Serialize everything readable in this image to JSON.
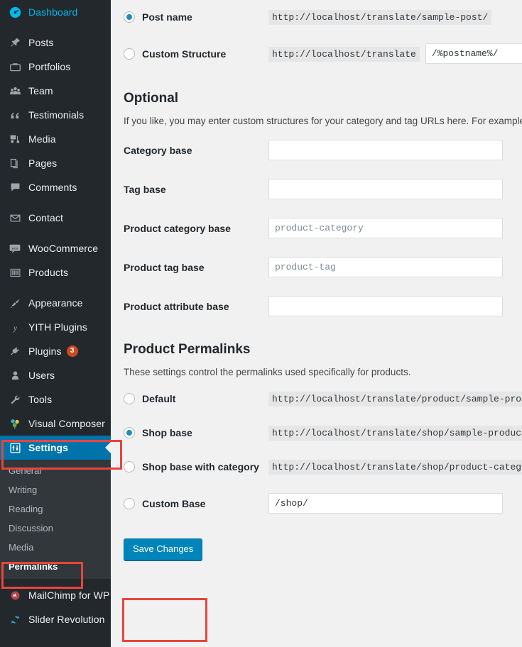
{
  "sidebar": {
    "items": [
      {
        "label": "Dashboard",
        "icon": "dashboard-icon",
        "state": "dashboard"
      },
      {
        "label": "Posts",
        "icon": "pin-icon",
        "state": "gap"
      },
      {
        "label": "Portfolios",
        "icon": "portfolio-icon",
        "state": ""
      },
      {
        "label": "Team",
        "icon": "team-icon",
        "state": ""
      },
      {
        "label": "Testimonials",
        "icon": "quote-icon",
        "state": ""
      },
      {
        "label": "Media",
        "icon": "media-icon",
        "state": ""
      },
      {
        "label": "Pages",
        "icon": "pages-icon",
        "state": ""
      },
      {
        "label": "Comments",
        "icon": "comments-icon",
        "state": ""
      },
      {
        "label": "Contact",
        "icon": "envelope-icon",
        "state": "gap"
      },
      {
        "label": "WooCommerce",
        "icon": "woocommerce-icon",
        "state": "gap"
      },
      {
        "label": "Products",
        "icon": "products-icon",
        "state": ""
      },
      {
        "label": "Appearance",
        "icon": "appearance-icon",
        "state": "gap"
      },
      {
        "label": "YITH Plugins",
        "icon": "yith-icon",
        "state": ""
      },
      {
        "label": "Plugins",
        "icon": "plugins-icon",
        "state": "",
        "badge": "3"
      },
      {
        "label": "Users",
        "icon": "users-icon",
        "state": ""
      },
      {
        "label": "Tools",
        "icon": "tools-icon",
        "state": ""
      },
      {
        "label": "Visual Composer",
        "icon": "visual-composer-icon",
        "state": ""
      }
    ],
    "settings": {
      "label": "Settings",
      "icon": "settings-icon"
    },
    "submenu": [
      {
        "label": "General",
        "active": false
      },
      {
        "label": "Writing",
        "active": false
      },
      {
        "label": "Reading",
        "active": false
      },
      {
        "label": "Discussion",
        "active": false
      },
      {
        "label": "Media",
        "active": false
      },
      {
        "label": "Permalinks",
        "active": true
      }
    ],
    "bottom_items": [
      {
        "label": "MailChimp for WP",
        "icon": "mailchimp-icon"
      },
      {
        "label": "Slider Revolution",
        "icon": "slider-revolution-icon"
      }
    ]
  },
  "permalink_settings": {
    "common_options": [
      {
        "label": "Post name",
        "checked": true,
        "example": "http://localhost/translate/sample-post/"
      },
      {
        "label": "Custom Structure",
        "checked": false,
        "prefix": "http://localhost/translate",
        "value": "/%postname%/"
      }
    ]
  },
  "optional": {
    "heading": "Optional",
    "description": "If you like, you may enter custom structures for your category and tag URLs here. For example, us",
    "fields": [
      {
        "label": "Category base",
        "value": "",
        "placeholder": ""
      },
      {
        "label": "Tag base",
        "value": "",
        "placeholder": ""
      },
      {
        "label": "Product category base",
        "value": "",
        "placeholder": "product-category"
      },
      {
        "label": "Product tag base",
        "value": "",
        "placeholder": "product-tag"
      },
      {
        "label": "Product attribute base",
        "value": "",
        "placeholder": ""
      }
    ]
  },
  "product_permalinks": {
    "heading": "Product Permalinks",
    "description": "These settings control the permalinks used specifically for products.",
    "options": [
      {
        "label": "Default",
        "checked": false,
        "example": "http://localhost/translate/product/sample-prod"
      },
      {
        "label": "Shop base",
        "checked": true,
        "example": "http://localhost/translate/shop/sample-product"
      },
      {
        "label": "Shop base with category",
        "checked": false,
        "example": "http://localhost/translate/shop/product-catego"
      },
      {
        "label": "Custom Base",
        "checked": false,
        "value": "/shop/"
      }
    ]
  },
  "submit": {
    "save_label": "Save Changes"
  },
  "colors": {
    "sidebar_bg": "#23282d",
    "submenu_bg": "#32373c",
    "accent": "#0073aa",
    "button": "#0085ba",
    "badge": "#ca4a1f",
    "annotation": "#e8453c",
    "dashboard_blue": "#00b9eb"
  }
}
